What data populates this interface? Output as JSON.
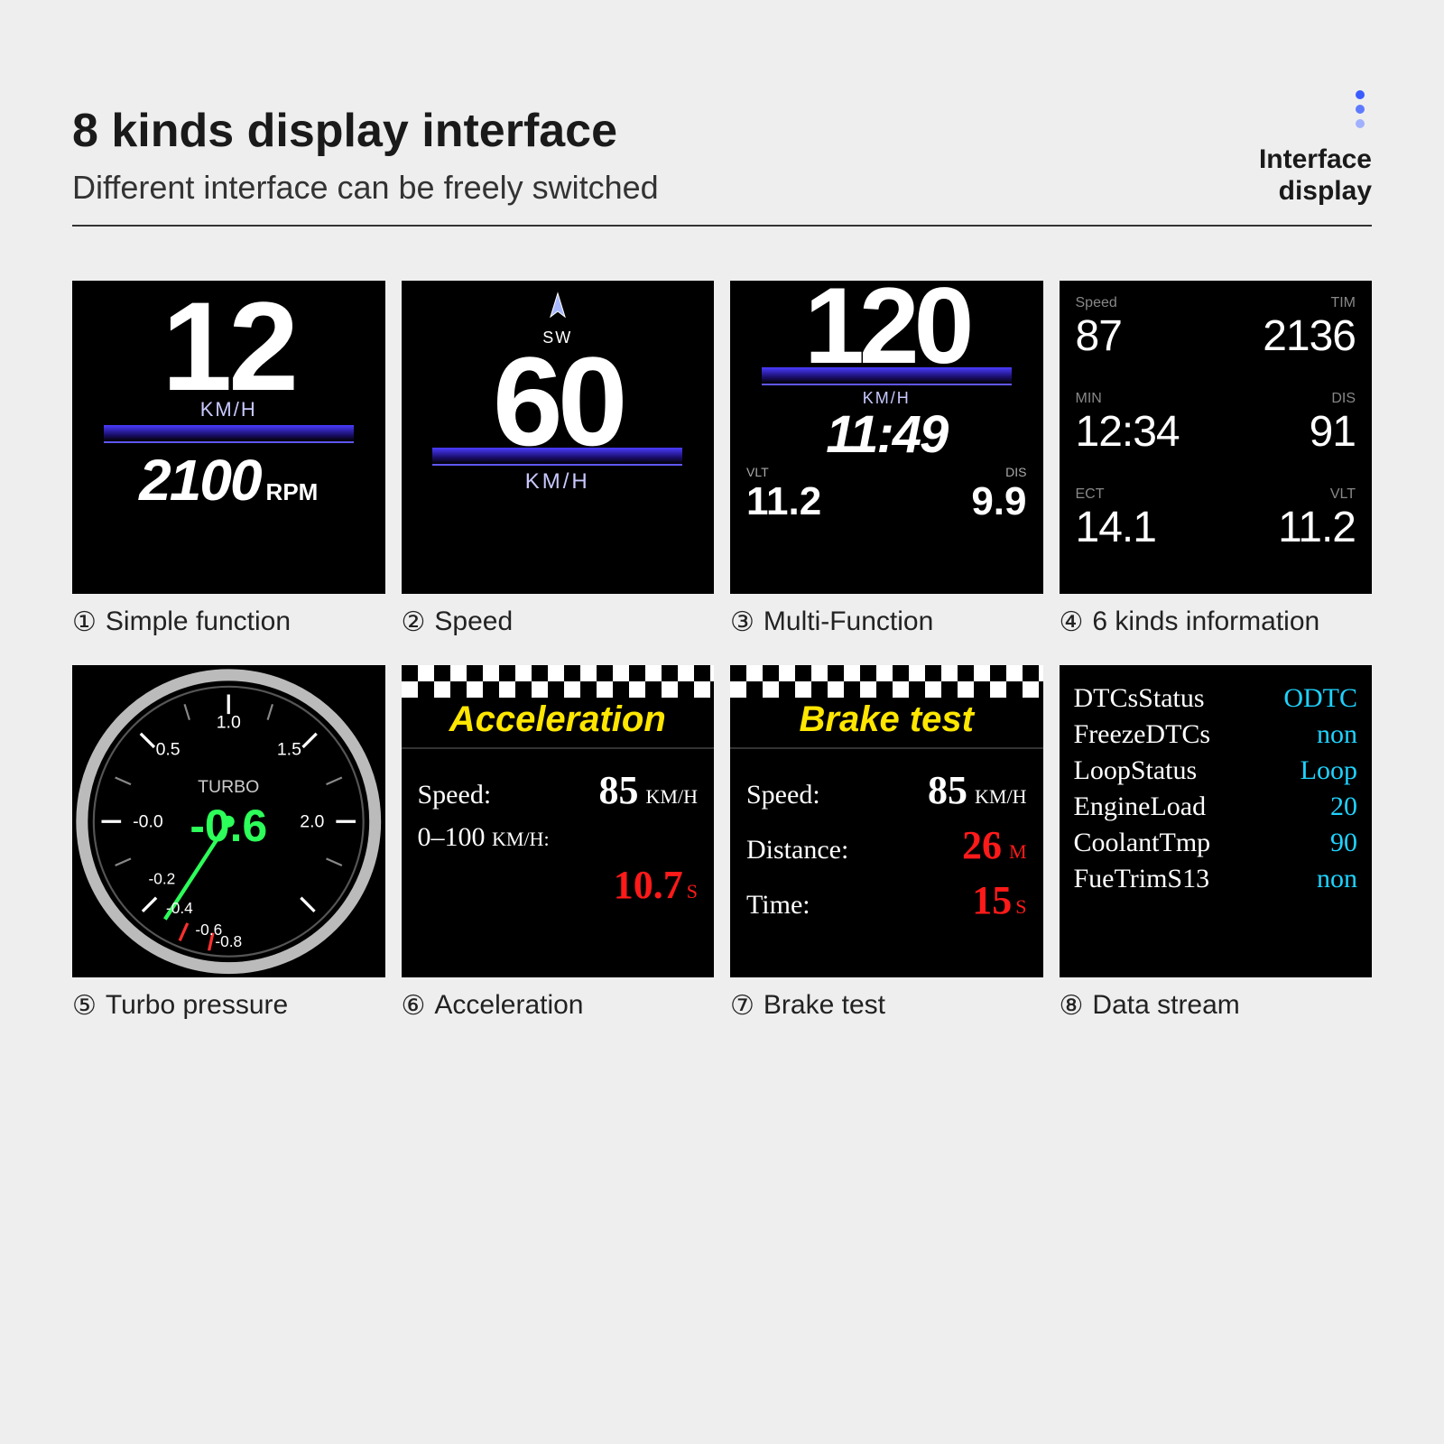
{
  "header": {
    "title": "8 kinds display interface",
    "subtitle": "Different interface can be freely switched",
    "right1": "Interface",
    "right2": "display"
  },
  "captions": [
    {
      "n": "①",
      "text": "Simple function"
    },
    {
      "n": "②",
      "text": "Speed"
    },
    {
      "n": "③",
      "text": "Multi-Function"
    },
    {
      "n": "④",
      "text": "6 kinds information"
    },
    {
      "n": "⑤",
      "text": "Turbo pressure"
    },
    {
      "n": "⑥",
      "text": "Acceleration"
    },
    {
      "n": "⑦",
      "text": "Brake test"
    },
    {
      "n": "⑧",
      "text": "Data stream"
    }
  ],
  "s1": {
    "speed": "12",
    "kmh": "KM/H",
    "rpm": "2100",
    "rpmLabel": "RPM"
  },
  "s2": {
    "dir": "SW",
    "speed": "60",
    "kmh": "KM/H"
  },
  "s3": {
    "speed": "120",
    "kmh": "KM/H",
    "time": "11:49",
    "vltLabel": "VLT",
    "vlt": "11.2",
    "disLabel": "DIS",
    "dis": "9.9"
  },
  "s4": {
    "cells": [
      {
        "lab": "Speed",
        "val": "87"
      },
      {
        "lab": "TIM",
        "val": "2136"
      },
      {
        "lab": "MIN",
        "val": "12:34"
      },
      {
        "lab": "DIS",
        "val": "91"
      },
      {
        "lab": "ECT",
        "val": "14.1"
      },
      {
        "lab": "VLT",
        "val": "11.2"
      }
    ]
  },
  "s5": {
    "label": "TURBO",
    "value": "-0.6",
    "ticks": [
      "-0.8",
      "-0.6",
      "-0.4",
      "-0.2",
      "-0.0",
      "0.5",
      "1.0",
      "1.5",
      "2.0"
    ]
  },
  "s6": {
    "title": "Acceleration",
    "speedLabel": "Speed:",
    "speed": "85",
    "speedUnit": "KM/H",
    "rangeLabel": "0–100",
    "rangeUnit": "KM/H:",
    "time": "10.7",
    "timeUnit": "S"
  },
  "s7": {
    "title": "Brake test",
    "speedLabel": "Speed:",
    "speed": "85",
    "speedUnit": "KM/H",
    "distLabel": "Distance:",
    "dist": "26",
    "distUnit": "M",
    "timeLabel": "Time:",
    "time": "15",
    "timeUnit": "S"
  },
  "s8": {
    "rows": [
      {
        "lab": "DTCsStatus",
        "val": "ODTC"
      },
      {
        "lab": "FreezeDTCs",
        "val": "non"
      },
      {
        "lab": "LoopStatus",
        "val": "Loop"
      },
      {
        "lab": "EngineLoad",
        "val": "20"
      },
      {
        "lab": "CoolantTmp",
        "val": "90"
      },
      {
        "lab": "FueTrimS13",
        "val": "non"
      }
    ]
  }
}
